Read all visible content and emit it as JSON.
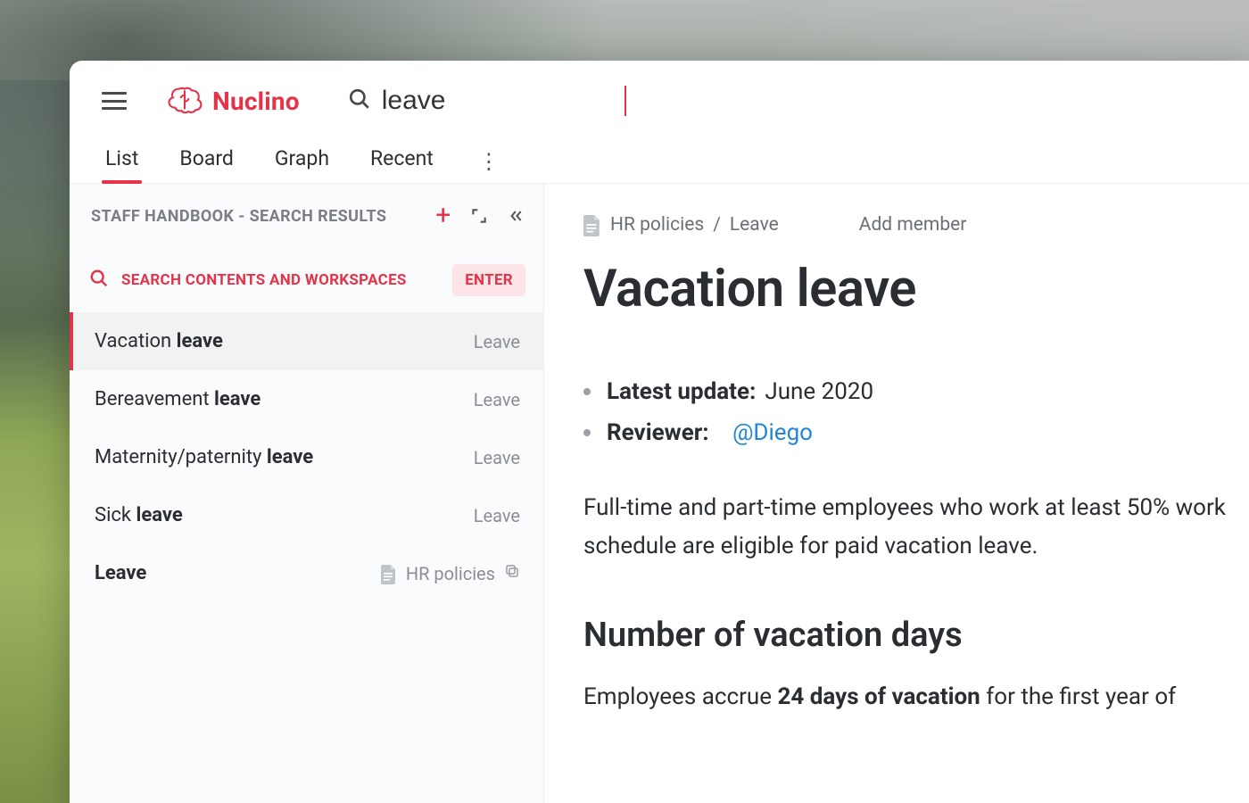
{
  "brand": {
    "name": "Nuclino"
  },
  "search": {
    "value": "leave"
  },
  "tabs": {
    "list": "List",
    "board": "Board",
    "graph": "Graph",
    "recent": "Recent",
    "active": "list"
  },
  "sidebar": {
    "header": "STAFF HANDBOOK - SEARCH RESULTS",
    "search_prompt": "SEARCH CONTENTS AND WORKSPACES",
    "enter_badge": "ENTER",
    "results": [
      {
        "prefix": "Vacation ",
        "match": "leave",
        "suffix": "",
        "category": "Leave",
        "active": true
      },
      {
        "prefix": "Bereavement ",
        "match": "leave",
        "suffix": "",
        "category": "Leave",
        "active": false
      },
      {
        "prefix": "Maternity/paternity ",
        "match": "leave",
        "suffix": "",
        "category": "Leave",
        "active": false
      },
      {
        "prefix": "Sick ",
        "match": "leave",
        "suffix": "",
        "category": "Leave",
        "active": false
      },
      {
        "prefix": "",
        "match": "Leave",
        "suffix": "",
        "category": "HR policies",
        "active": false,
        "has_doc_icon": true,
        "has_copy_icon": true
      }
    ]
  },
  "breadcrumb": {
    "parent": "HR policies",
    "sep": " / ",
    "current": "Leave"
  },
  "add_member": "Add member",
  "page": {
    "title": "Vacation leave",
    "meta": {
      "update_label": "Latest update:",
      "update_value": " June 2020",
      "reviewer_label": "Reviewer:",
      "reviewer_value": "@Diego"
    },
    "para1": "Full-time and part-time employees who work at least 50% work schedule are eligible for paid vacation leave.",
    "h2": "Number of vacation days",
    "para2_a": "Employees accrue ",
    "para2_b": "24 days of vacation",
    "para2_c": " for the first year of"
  }
}
